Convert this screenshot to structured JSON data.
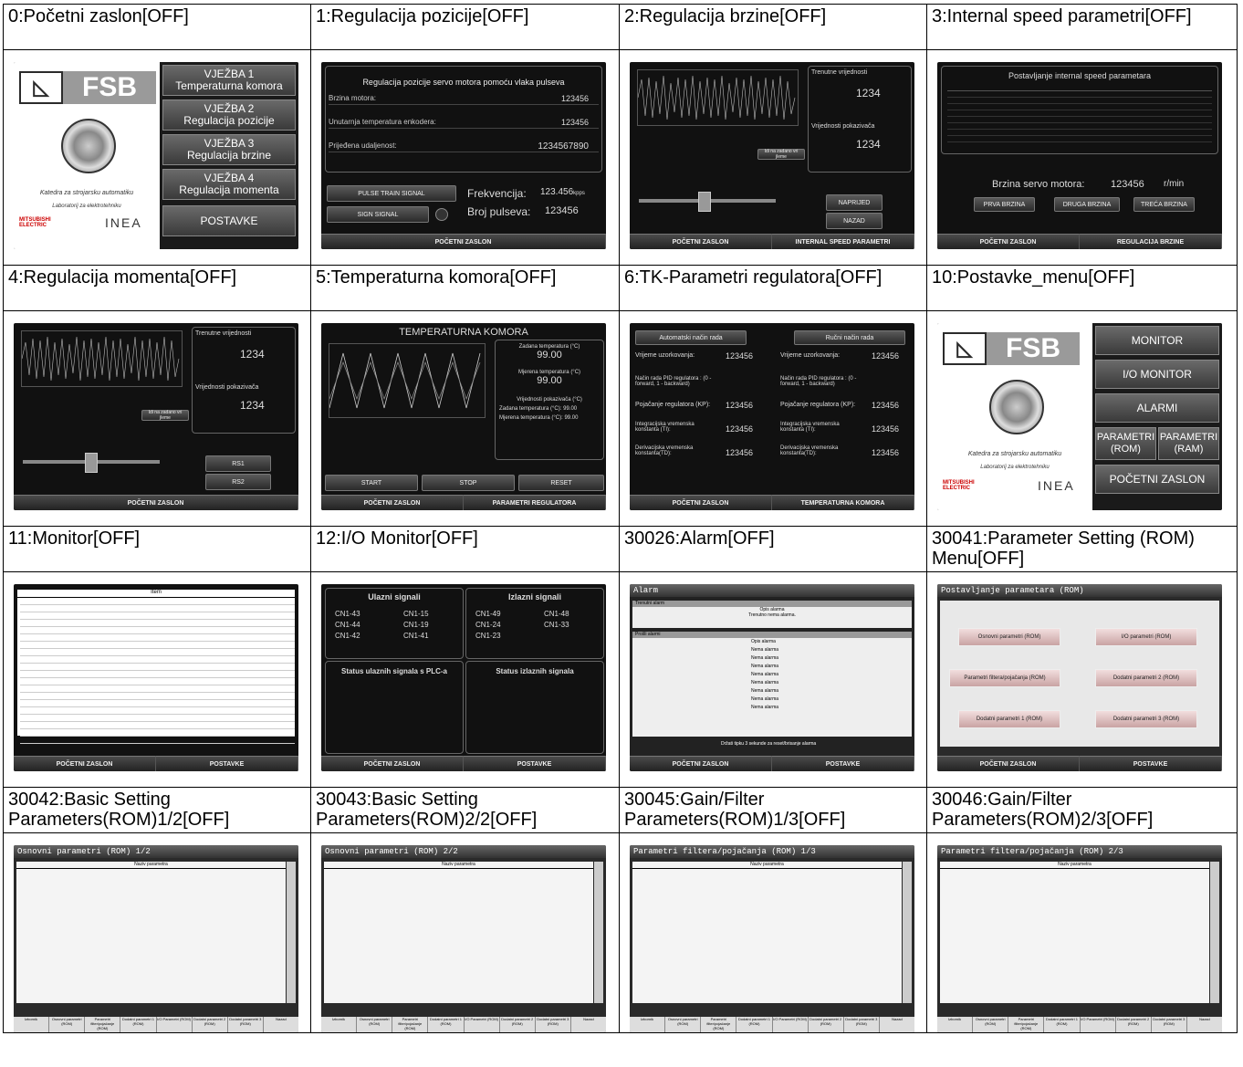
{
  "captions": [
    "0:Početni zaslon[OFF]",
    "1:Regulacija pozicije[OFF]",
    "2:Regulacija brzine[OFF]",
    "3:Internal speed parametri[OFF]",
    "4:Regulacija momenta[OFF]",
    "5:Temperaturna komora[OFF]",
    "6:TK-Parametri regulatora[OFF]",
    "10:Postavke_menu[OFF]",
    "11:Monitor[OFF]",
    "12:I/O Monitor[OFF]",
    "30026:Alarm[OFF]",
    "30041:Parameter Setting (ROM) Menu[OFF]",
    "30042:Basic Setting Parameters(ROM)1/2[OFF]",
    "30043:Basic Setting Parameters(ROM)2/2[OFF]",
    "30045:Gain/Filter Parameters(ROM)1/3[OFF]",
    "30046:Gain/Filter Parameters(ROM)2/3[OFF]"
  ],
  "s0": {
    "logo_left": "└♂",
    "logo_right": "FSB",
    "dept": "Katedra za strojarsku automatiku",
    "lab": "Laboratorij za elektrotehniku",
    "brand1": "MITSUBISHI ELECTRIC",
    "brand2": "INEA",
    "b1": "VJEŽBA 1\nTemperaturna komora",
    "b2": "VJEŽBA 2\nRegulacija pozicije",
    "b3": "VJEŽBA 3\nRegulacija brzine",
    "b4": "VJEŽBA 4\nRegulacija momenta",
    "b5": "POSTAVKE"
  },
  "s1": {
    "title": "Regulacija pozicije servo motora pomoću vlaka pulseva",
    "r1": "Brzina motora:",
    "r2": "Unutarnja temperatura enkodera:",
    "r3": "Prijeđena udaljenost:",
    "v1": "123456",
    "v2": "123456",
    "v3": "1234567890",
    "pulse": "PULSE TRAIN SIGNAL",
    "sign": "SIGN SIGNAL",
    "freq": "Frekvencija:",
    "freq_val": "123.456",
    "freq_unit": "kpps",
    "count": "Broj pulseva:",
    "count_val": "123456",
    "nav": "POČETNI ZASLON"
  },
  "s2": {
    "cur": "Trenutne vrijednosti",
    "ind": "Vrijednosti pokazivača",
    "apply": "Idi na zadano vri jleme",
    "fwd": "NAPRIJED",
    "back": "NAZAD",
    "nav1": "POČETNI ZASLON",
    "nav2": "INTERNAL SPEED PARAMETRI"
  },
  "s3": {
    "title": "Postavljanje internal speed parametara",
    "speed": "Brzina servo motora:",
    "speed_val": "123456",
    "unit": "r/min",
    "b1": "PRVA BRZINA",
    "b2": "DRUGA BRZINA",
    "b3": "TREĆA BRZINA",
    "nav1": "POČETNI ZASLON",
    "nav2": "REGULACIJA BRZINE"
  },
  "s4": {
    "cur": "Trenutne vrijednosti",
    "ind": "Vrijednosti pokazivača",
    "apply": "Idi na zadano vri jleme",
    "rs1": "RS1",
    "rs2": "RS2",
    "nav": "POČETNI ZASLON"
  },
  "s5": {
    "title": "TEMPERATURNA KOMORA",
    "set": "Zadana temperatura (°C)",
    "meas": "Mjerena temperatura (°C)",
    "ind": "Vrijednosti pokazivača (°C)",
    "set2": "Zadana temperatura (°C):",
    "meas2": "Mjerena temperatura (°C):",
    "val": "99.00",
    "start": "START",
    "stop": "STOP",
    "reset": "RESET",
    "nav1": "POČETNI ZASLON",
    "nav2": "PARAMETRI REGULATORA"
  },
  "s6": {
    "auto": "Automatski način rada",
    "manual": "Ručni način rada",
    "sample": "Vrijeme uzorkovanja:",
    "mode": "Način rada PID regulatora : (0 - forward, 1 - backward)",
    "gain": "Pojačanje regulatora (KP):",
    "ti": "Integracijska vremenska konstanta (TI):",
    "td": "Derivacijska vremenska konstanta(TD):",
    "val": "123456",
    "nav1": "POČETNI ZASLON",
    "nav2": "TEMPERATURNA KOMORA"
  },
  "s10": {
    "b1": "MONITOR",
    "b2": "I/O MONITOR",
    "b3": "ALARMI",
    "b4": "PARAMETRI\n(ROM)",
    "b5": "PARAMETRI\n(RAM)",
    "b6": "POČETNI ZASLON"
  },
  "s11": {
    "item": "Item",
    "nav1": "POČETNI ZASLON",
    "nav2": "POSTAVKE"
  },
  "s12": {
    "in": "Ulazni signali",
    "out": "Izlazni signali",
    "in_list": [
      "CN1-43",
      "CN1-15",
      "CN1-44",
      "CN1-19",
      "CN1-42",
      "CN1-41"
    ],
    "out_list": [
      "CN1-49",
      "CN1-48",
      "CN1-24",
      "CN1-33",
      "CN1-23"
    ],
    "st_in": "Status ulaznih signala s PLC-a",
    "st_out": "Status izlaznih signala",
    "nav1": "POČETNI ZASLON",
    "nav2": "POSTAVKE"
  },
  "s30026": {
    "title": "Alarm",
    "cur": "Trenutni alarm",
    "desc": "Opis alarma",
    "none": "Trenutno nema alarma.",
    "past": "Prošli alarmi",
    "nema": "Nema alarma",
    "hint": "Držati tipku 3 sekunde za reset/brisanje alarma",
    "nav1": "POČETNI ZASLON",
    "nav2": "POSTAVKE"
  },
  "s30041": {
    "title": "Postavljanje parametara (ROM)",
    "b1": "Osnovni parametri (ROM)",
    "b2": "I/O parametri (ROM)",
    "b3": "Parametri filtera/pojačanja (ROM)",
    "b4": "Dodatni parametri 2 (ROM)",
    "b5": "Dodatni parametri 1 (ROM)",
    "b6": "Dodatni parametri 3 (ROM)",
    "nav1": "POČETNI ZASLON",
    "nav2": "POSTAVKE"
  },
  "s30042": {
    "title": "Osnovni parametri (ROM) 1/2",
    "col": "Naziv parametra"
  },
  "s30043": {
    "title": "Osnovni parametri (ROM) 2/2",
    "col": "Naziv parametra"
  },
  "s30045": {
    "title": "Parametri filtera/pojačanja (ROM) 1/3",
    "col": "Naziv parametra"
  },
  "s30046": {
    "title": "Parametri filtera/pojačanja (ROM) 2/3",
    "col": "Naziv parametra"
  },
  "bottom_tabs": [
    "Izbornik",
    "Osnovni parametri (ROM)",
    "Parametri filter/pojačanje (ROM)",
    "Dodatni parametri 1 (ROM)",
    "I/O Parametri (ROM)",
    "Dodatni parametri 2 (ROM)",
    "Dodatni parametri 3 (ROM)",
    "Nazad"
  ]
}
